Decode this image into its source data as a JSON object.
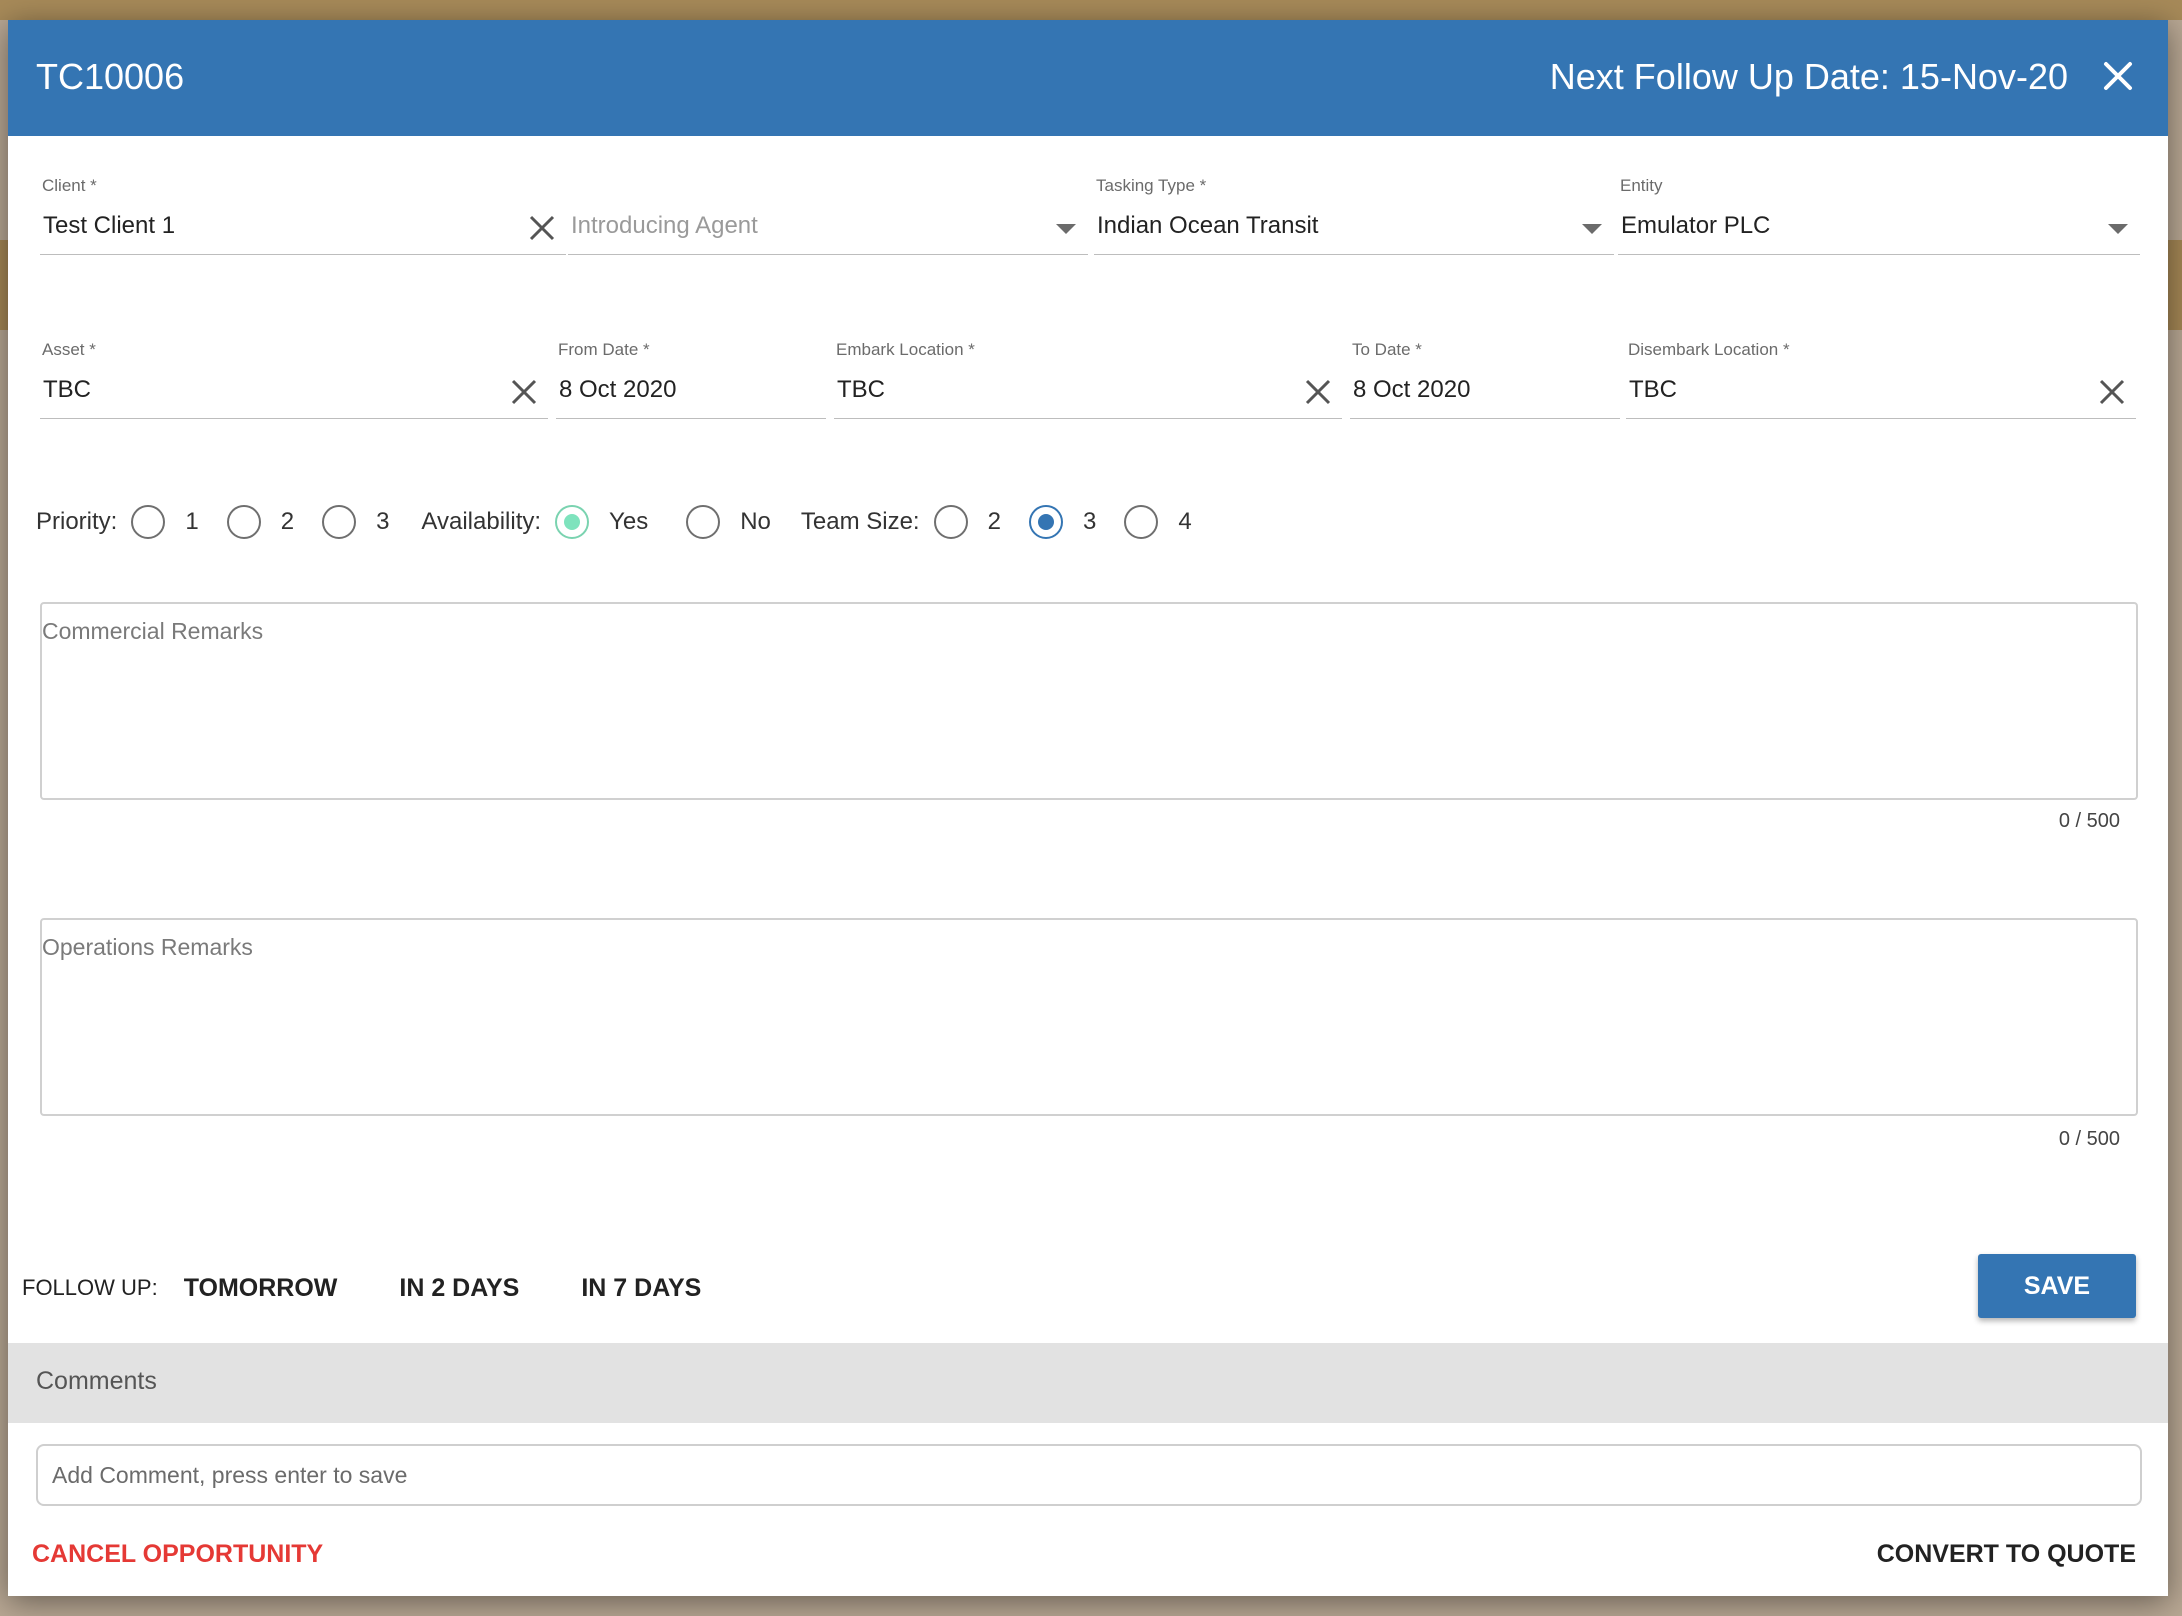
{
  "dialog": {
    "reference": "TC10006",
    "next_follow_up_label": "Next Follow Up Date:",
    "next_follow_up_date": "15-Nov-20"
  },
  "fields": {
    "client": {
      "label": "Client *",
      "value": "Test Client 1"
    },
    "introducing_agent": {
      "placeholder": "Introducing Agent"
    },
    "tasking_type": {
      "label": "Tasking Type *",
      "value": "Indian Ocean Transit"
    },
    "entity": {
      "label": "Entity",
      "value": "Emulator PLC"
    },
    "asset": {
      "label": "Asset *",
      "value": "TBC"
    },
    "from_date": {
      "label": "From Date *",
      "value": "8 Oct 2020"
    },
    "embark_location": {
      "label": "Embark Location *",
      "value": "TBC"
    },
    "to_date": {
      "label": "To Date *",
      "value": "8 Oct 2020"
    },
    "disembark_location": {
      "label": "Disembark Location *",
      "value": "TBC"
    }
  },
  "priority": {
    "label": "Priority:",
    "options": [
      "1",
      "2",
      "3"
    ],
    "selected": null
  },
  "availability": {
    "label": "Availability:",
    "options": [
      "Yes",
      "No"
    ],
    "selected": "Yes"
  },
  "team_size": {
    "label": "Team Size:",
    "options": [
      "2",
      "3",
      "4"
    ],
    "selected": "3"
  },
  "commercial_remarks": {
    "placeholder": "Commercial Remarks",
    "counter": "0 / 500"
  },
  "operations_remarks": {
    "placeholder": "Operations Remarks",
    "counter": "0 / 500"
  },
  "follow_up": {
    "label": "FOLLOW UP:",
    "options": [
      "TOMORROW",
      "IN 2 DAYS",
      "IN 7 DAYS"
    ],
    "save_label": "SAVE"
  },
  "comments": {
    "title": "Comments",
    "input_placeholder": "Add Comment, press enter to save"
  },
  "actions": {
    "cancel_label": "CANCEL OPPORTUNITY",
    "convert_label": "CONVERT TO QUOTE"
  },
  "colors": {
    "header": "#3475b3",
    "availability_selected": "#7ee3bd",
    "team_size_selected": "#3475b3",
    "cancel": "#e53935"
  }
}
